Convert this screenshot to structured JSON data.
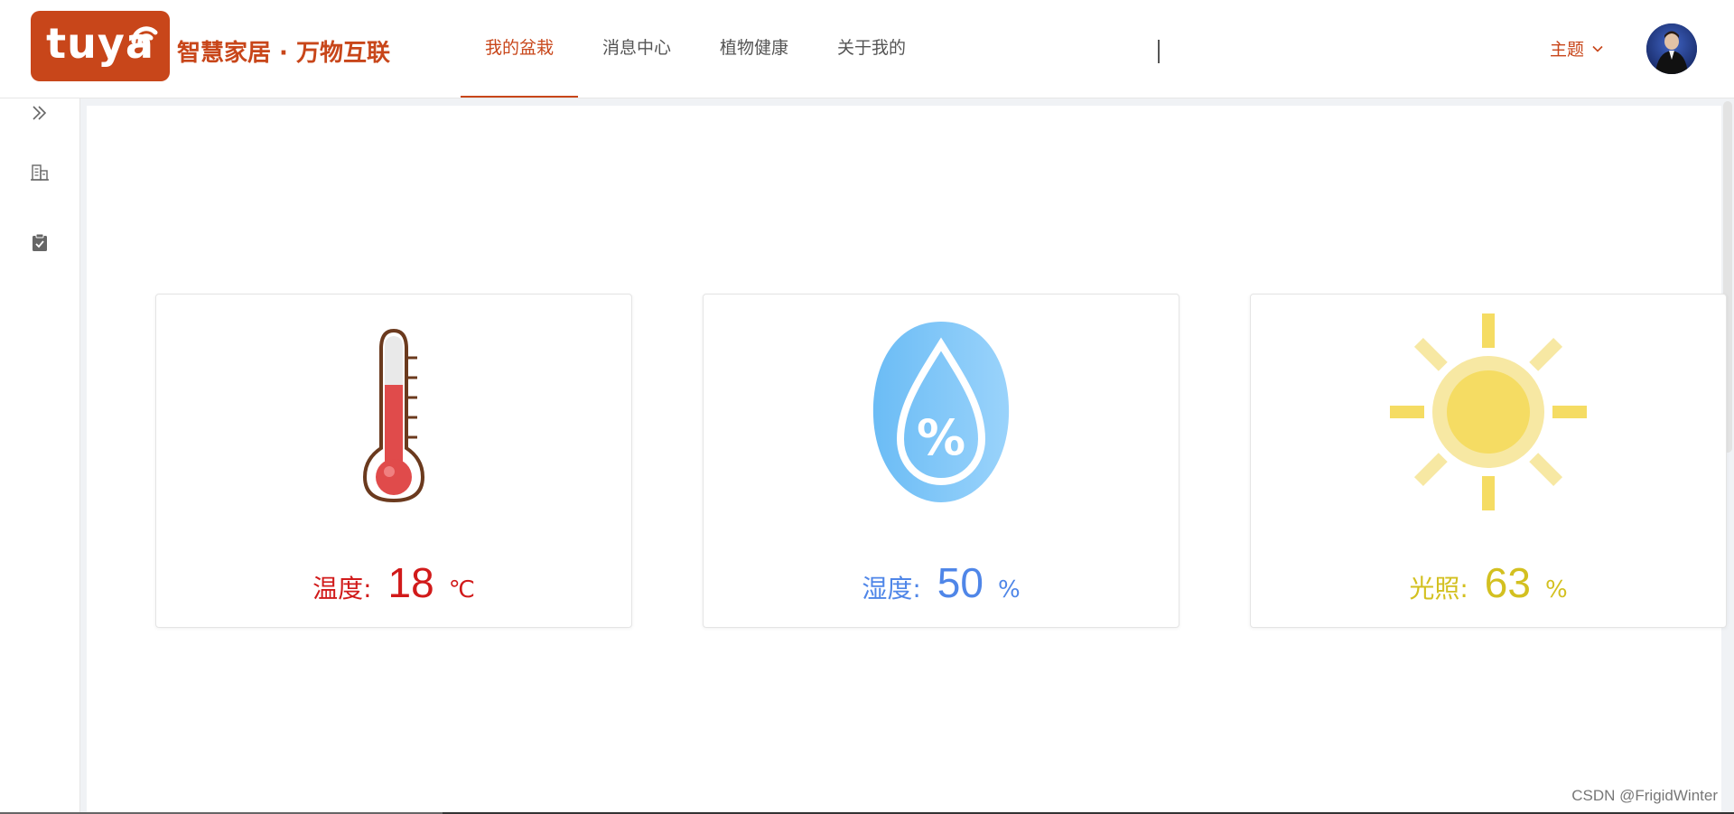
{
  "header": {
    "logo_word": "tuya",
    "tagline": "智慧家居 · 万物互联",
    "nav": [
      {
        "label": "我的盆栽",
        "active": true
      },
      {
        "label": "消息中心",
        "active": false
      },
      {
        "label": "植物健康",
        "active": false
      },
      {
        "label": "关于我的",
        "active": false
      }
    ],
    "theme_label": "主题",
    "icons": {
      "theme": "chevron-down-icon",
      "avatar": "user-avatar"
    }
  },
  "sidebar": {
    "items": [
      {
        "icon": "double-chevron-right-icon"
      },
      {
        "icon": "building-icon"
      },
      {
        "icon": "clipboard-check-icon"
      }
    ]
  },
  "cards": {
    "temperature": {
      "label": "温度:",
      "value": "18",
      "unit": "℃",
      "icon": "thermometer-icon",
      "color": "#d11a1a"
    },
    "humidity": {
      "label": "湿度:",
      "value": "50",
      "unit": "%",
      "icon": "water-drop-percent-icon",
      "color": "#4f86e8"
    },
    "light": {
      "label": "光照:",
      "value": "63",
      "unit": "%",
      "icon": "sun-icon",
      "color": "#d3c020"
    }
  },
  "watermark": "CSDN @FrigidWinter",
  "colors": {
    "brand": "#c8461a",
    "background": "#f0f2f5"
  }
}
